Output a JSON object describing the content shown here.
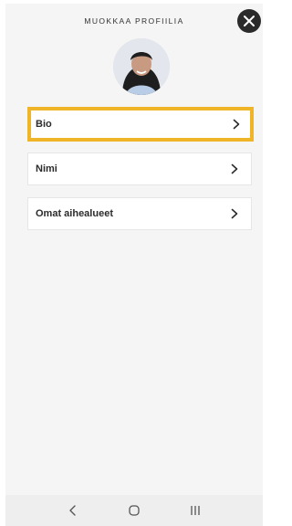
{
  "header": {
    "title": "MUOKKAA PROFIILIA"
  },
  "menu": {
    "items": [
      {
        "label": "Bio",
        "highlighted": true
      },
      {
        "label": "Nimi",
        "highlighted": false
      },
      {
        "label": "Omat aihealueet",
        "highlighted": false
      }
    ]
  },
  "colors": {
    "highlight": "#f0b429",
    "close_button": "#2b2b2b",
    "background": "#f5f5f5"
  },
  "icons": {
    "close": "close-icon",
    "chevron": "chevron-right-icon",
    "nav_back": "back-icon",
    "nav_home": "home-icon",
    "nav_recents": "recents-icon"
  }
}
